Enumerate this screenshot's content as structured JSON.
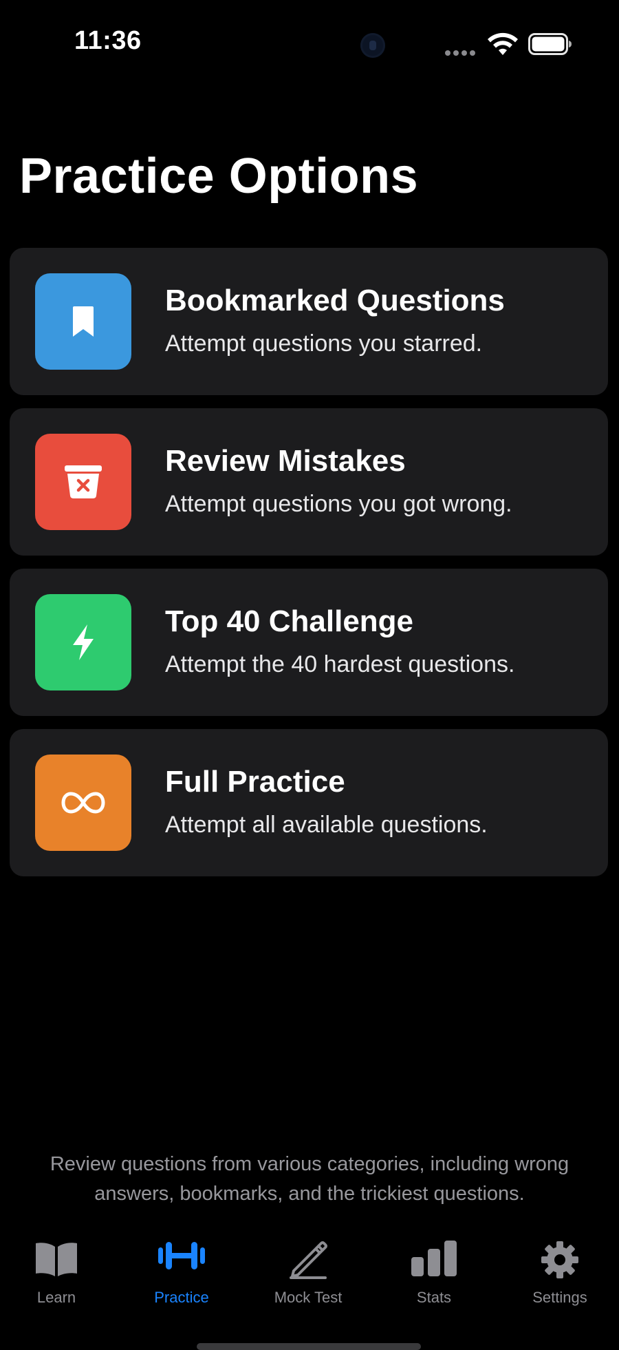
{
  "status_bar": {
    "time": "11:36"
  },
  "page_title": "Practice Options",
  "options": [
    {
      "title": "Bookmarked Questions",
      "description": "Attempt questions you starred.",
      "icon": "bookmark-icon",
      "color": "#3b98de"
    },
    {
      "title": "Review Mistakes",
      "description": "Attempt questions you got wrong.",
      "icon": "trash-x-icon",
      "color": "#e84d3d"
    },
    {
      "title": "Top 40 Challenge",
      "description": "Attempt the 40 hardest questions.",
      "icon": "bolt-icon",
      "color": "#2ecb6f"
    },
    {
      "title": "Full Practice",
      "description": "Attempt all available questions.",
      "icon": "infinity-icon",
      "color": "#e8822a"
    }
  ],
  "footer_note": {
    "line1": "Review questions from various categories, including wrong",
    "line2": "answers, bookmarks, and the trickiest questions."
  },
  "tabs": [
    {
      "label": "Learn",
      "icon": "book-icon",
      "active": false
    },
    {
      "label": "Practice",
      "icon": "dumbbell-icon",
      "active": true
    },
    {
      "label": "Mock Test",
      "icon": "pencil-icon",
      "active": false
    },
    {
      "label": "Stats",
      "icon": "bar-chart-icon",
      "active": false
    },
    {
      "label": "Settings",
      "icon": "gear-icon",
      "active": false
    }
  ],
  "colors": {
    "background": "#000000",
    "card": "#1c1c1e",
    "accent": "#1a84ff",
    "inactive": "#8e8e93"
  }
}
